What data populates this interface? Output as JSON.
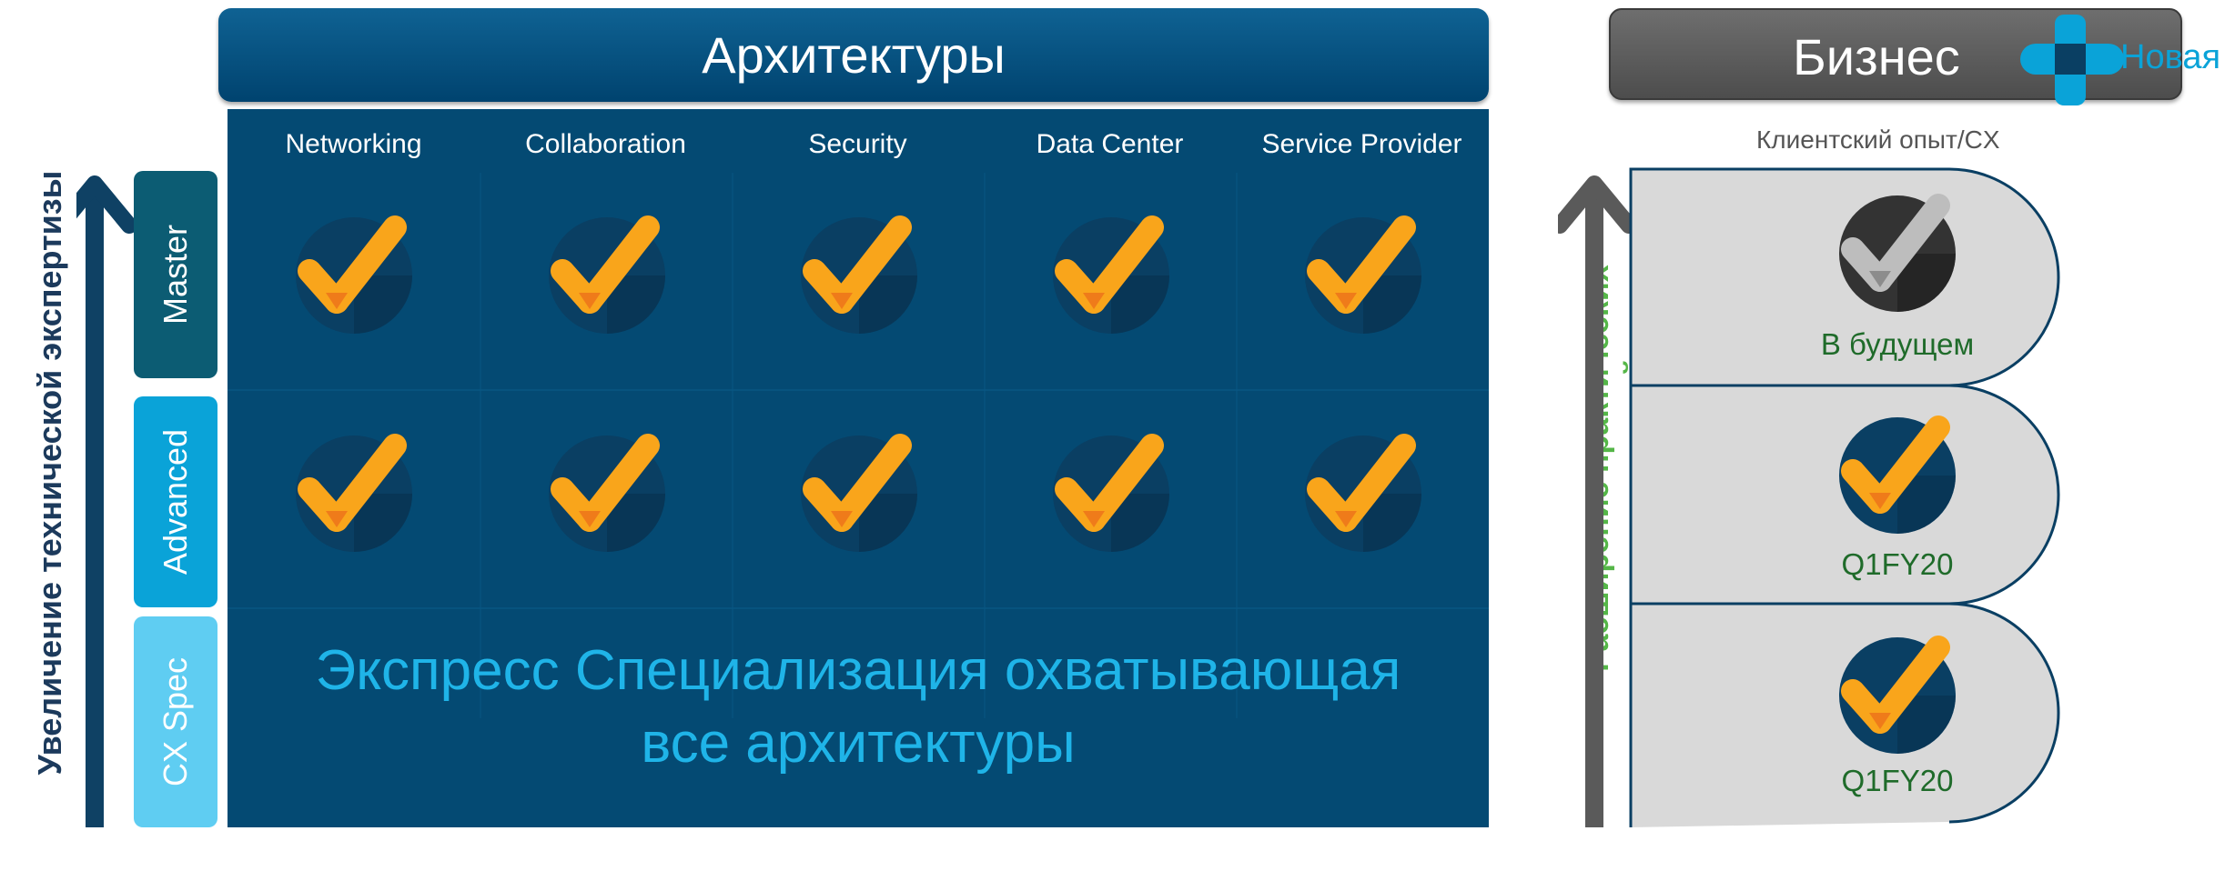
{
  "colors": {
    "header_blue": "#00436f",
    "matrix_blue": "#044a73",
    "master": "#0c5c73",
    "advanced": "#0aa3d8",
    "cx_spec": "#5fcdf2",
    "express_text": "#1fb4e8",
    "business_gray": "#5c5c5c",
    "new_accent": "#0aa3d8",
    "right_axis_green": "#55b648",
    "status_green": "#1f6b2a",
    "check_orange": "#f9a51b"
  },
  "left_axis": {
    "label": "Увеличение технической экспертизы"
  },
  "architectures": {
    "title": "Архитектуры",
    "columns": [
      "Networking",
      "Collaboration",
      "Security",
      "Data Center",
      "Service Provider"
    ]
  },
  "levels": [
    {
      "label": "Master"
    },
    {
      "label": "Advanced"
    },
    {
      "label": "CX Spec"
    }
  ],
  "express": {
    "line1": "Экспресс Специализация охватывающая",
    "line2": "все архитектуры"
  },
  "business": {
    "title": "Бизнес",
    "new_label": "Новая",
    "caption": "Клиентский опыт/CX",
    "axis_label_line1": "Расширение практических",
    "axis_label_line2": "возможностей",
    "items": [
      {
        "status": "В будущем",
        "icon": "check-gray-icon"
      },
      {
        "status": "Q1FY20",
        "icon": "check-orange-icon"
      },
      {
        "status": "Q1FY20",
        "icon": "check-orange-icon"
      }
    ]
  }
}
